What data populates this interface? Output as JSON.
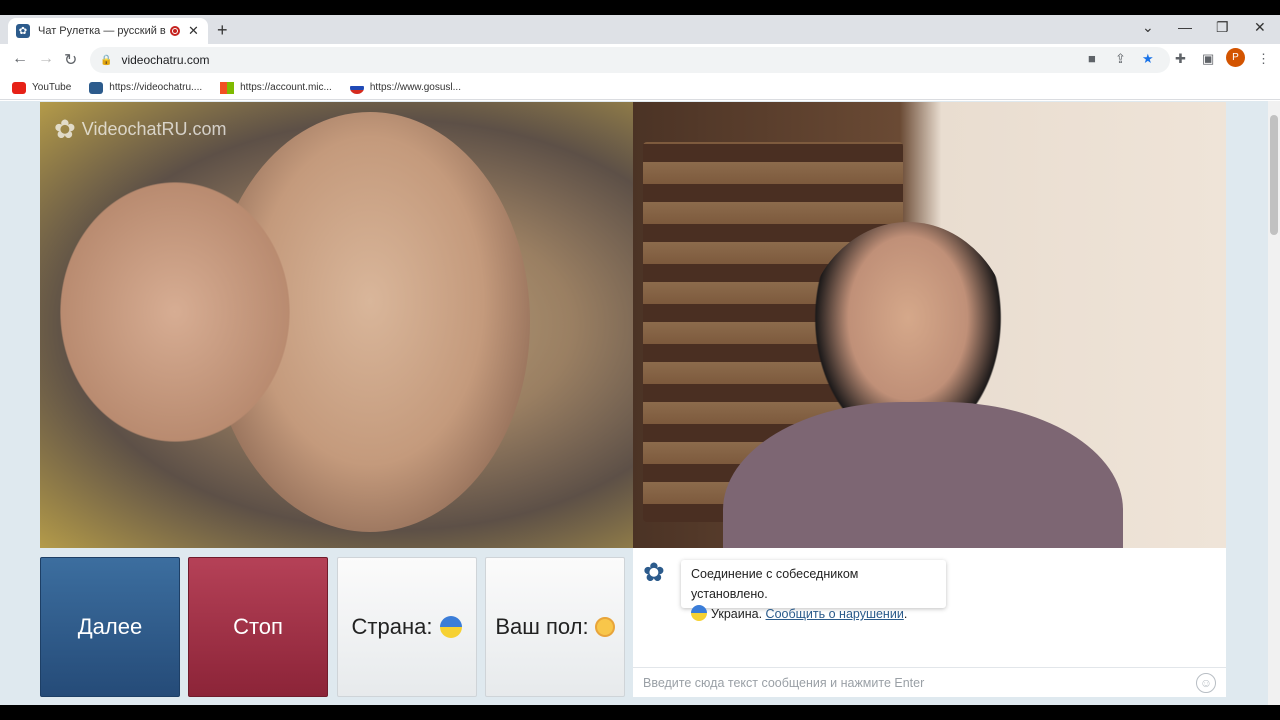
{
  "browser": {
    "tab_title": "Чат Рулетка — русский вид",
    "url": "videochatru.com",
    "profile_initial": "P",
    "bookmarks": [
      {
        "label": "YouTube",
        "icon": "youtube-icon"
      },
      {
        "label": "https://videochatru....",
        "icon": "videochat-icon"
      },
      {
        "label": "https://account.mic...",
        "icon": "microsoft-icon"
      },
      {
        "label": "https://www.gosusl...",
        "icon": "gosuslugi-icon"
      }
    ]
  },
  "video": {
    "watermark": "VideochatRU.com"
  },
  "controls": {
    "next_label": "Далее",
    "stop_label": "Стоп",
    "country_label": "Страна:",
    "gender_label": "Ваш пол:"
  },
  "chat": {
    "connected_text": "Соединение с собеседником установлено.",
    "country_text": "Украина.",
    "report_link": "Сообщить о нарушении",
    "input_placeholder": "Введите сюда текст сообщения и нажмите Enter"
  },
  "colors": {
    "next_button": "#2f5c8c",
    "stop_button": "#a3344a",
    "page_bg": "#dfe9ef"
  }
}
